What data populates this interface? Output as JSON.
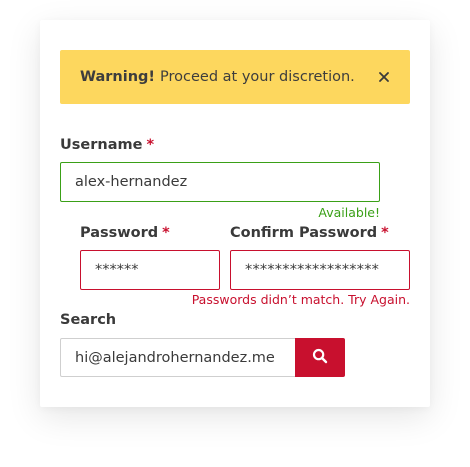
{
  "alert": {
    "title": "Warning!",
    "message": "Proceed at your discretion.",
    "close_icon": "close-icon",
    "background": "#fdd75e"
  },
  "username": {
    "label": "Username",
    "required_mark": "*",
    "value": "alex-hernandez",
    "hint": "Available!"
  },
  "password": {
    "label": "Password",
    "required_mark": "*",
    "value": "******"
  },
  "confirm_password": {
    "label": "Confirm Password",
    "required_mark": "*",
    "value": "******************",
    "hint": "Passwords didn’t match. Try Again."
  },
  "search": {
    "label": "Search",
    "value": "hi@alejandrohernandez.me",
    "button_icon": "search-icon"
  },
  "colors": {
    "success": "#3aa017",
    "error": "#c8102e",
    "accent": "#c8102e"
  }
}
